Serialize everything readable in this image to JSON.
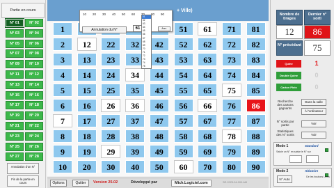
{
  "left_panel": {
    "title": "Partie en cours",
    "games": [
      "N° 01",
      "N° 02",
      "N° 03",
      "N° 04",
      "N° 05",
      "N° 06",
      "N° 07",
      "N° 08",
      "N° 09",
      "N° 10",
      "N° 11",
      "N° 12",
      "N° 13",
      "N° 14",
      "N° 15",
      "N° 16",
      "N° 17",
      "N° 18",
      "N° 19",
      "N° 20",
      "N° 21",
      "N° 22",
      "N° 23",
      "N° 24",
      "N° 25",
      "N° 26",
      "N° 27",
      "N° 28"
    ],
    "selected_game": "N° 01",
    "cancel_button": "Annulation d'un N°",
    "end_button": "Fin de la partie en cours"
  },
  "topbar": {
    "title_fragment": "+ Ville)"
  },
  "dropdown": {
    "options": [
      "10",
      "20",
      "30",
      "40",
      "50",
      "60",
      "70",
      "80",
      "90"
    ],
    "list": [
      "61",
      "62",
      "63",
      "64",
      "65",
      "66",
      "67",
      "68",
      "69",
      "70",
      "71",
      "72",
      "73",
      "74",
      "75"
    ],
    "highlighted": "61",
    "value": "61",
    "cancel_number_button": "Annulation du N°",
    "aux_button": "Ann."
  },
  "grid": {
    "columns": [
      [
        1,
        2,
        3,
        4,
        5,
        6,
        7,
        8,
        9,
        10
      ],
      [
        11,
        12,
        13,
        14,
        15,
        16,
        17,
        18,
        19,
        20
      ],
      [
        21,
        22,
        23,
        24,
        25,
        26,
        27,
        28,
        29,
        30
      ],
      [
        31,
        32,
        33,
        34,
        35,
        36,
        37,
        38,
        39,
        40
      ],
      [
        41,
        42,
        43,
        44,
        45,
        46,
        47,
        48,
        49,
        50
      ],
      [
        51,
        52,
        53,
        54,
        55,
        56,
        57,
        58,
        59,
        60
      ],
      [
        61,
        62,
        63,
        64,
        65,
        66,
        67,
        68,
        69,
        70
      ],
      [
        71,
        72,
        73,
        74,
        75,
        76,
        77,
        78,
        79,
        80
      ],
      [
        81,
        82,
        83,
        84,
        85,
        86,
        87,
        88,
        89,
        90
      ]
    ],
    "drawn": [
      7,
      12,
      26,
      29,
      34,
      36,
      60,
      61,
      66,
      75,
      78,
      86
    ],
    "last": 86
  },
  "bottom": {
    "options_button": "Options",
    "quit_button": "Quitter",
    "version": "Version 25.02",
    "developed_by": "Développé par",
    "website": "Mich.Logiciel.com",
    "serial": "SR-2025-04-000-AM"
  },
  "right_panel": {
    "draws_label": "Nombre de tirages",
    "last_label": "Dernier n° sorti",
    "draws_value": "12",
    "last_value": "86",
    "previous_label": "N° précédant",
    "previous_value": "75",
    "quine_label": "Quine",
    "quine_value": "1",
    "double_quine_label": "Double Quine",
    "double_quine_value": "0",
    "carton_plein_label": "Carton Plein",
    "carton_plein_value": "0",
    "search_label": "Recherche des cartons gagnants",
    "search_button_1": "Dans la salle",
    "search_button_2": "À l'ordinateur",
    "out_number_label": "N° sortis par partie",
    "out_number_button": "Voir",
    "stats_label": "Statistiques des N° sortis",
    "stats_button": "Voir",
    "mode1_label": "Mode 1",
    "mode1_value": "Standard",
    "mode1_desc": "Saisie un N° en saisie le N° sur",
    "mode2_label": "Mode 2",
    "mode2_value": "Aléatoire",
    "auto_button": "N° Auto",
    "mode2_desc": "De les boutons Liens"
  },
  "colors": {
    "cell": "#8ec8ee",
    "drawn": "#ffffff",
    "last": "#e8141a",
    "game": "#3cb84a",
    "header": "#4d6f8f"
  }
}
